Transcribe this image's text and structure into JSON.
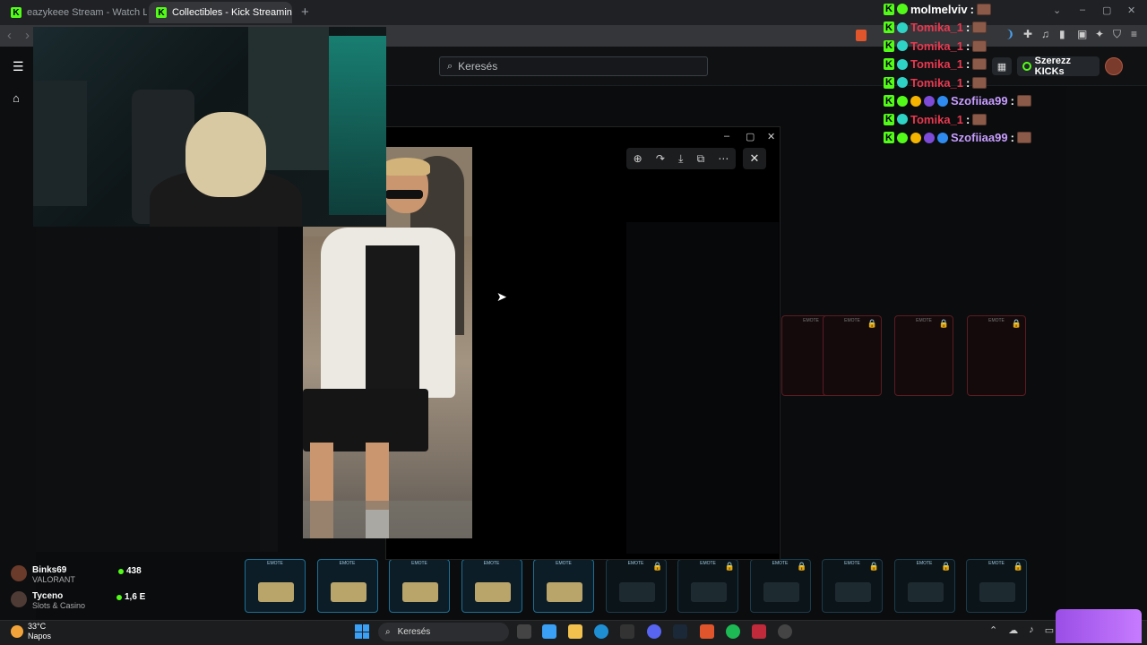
{
  "browser": {
    "tabs": [
      {
        "title": "eazykeee Stream - Watch Live on Kic",
        "active": false
      },
      {
        "title": "Collectibles - Kick Streaming",
        "active": true
      }
    ],
    "new_tab": "+",
    "window_controls": [
      "–",
      "▢",
      "✕"
    ]
  },
  "kick": {
    "search_placeholder": "Keresés",
    "earn_button": "Szerezz KICKs",
    "accent": "#53fc18"
  },
  "chat": [
    {
      "user": "molmelviv",
      "color": "#ffffff",
      "badges": [
        "sub"
      ]
    },
    {
      "user": "Tomika_1",
      "color": "#e8384f",
      "badges": [
        "sub-teal"
      ]
    },
    {
      "user": "Tomika_1",
      "color": "#e8384f",
      "badges": [
        "sub-teal"
      ]
    },
    {
      "user": "Tomika_1",
      "color": "#e8384f",
      "badges": [
        "sub-teal"
      ]
    },
    {
      "user": "Tomika_1",
      "color": "#e8384f",
      "badges": [
        "sub-teal"
      ]
    },
    {
      "user": "Szofiiaa99",
      "color": "#c89dff",
      "badges": [
        "sub",
        "crown",
        "gift",
        "vip"
      ]
    },
    {
      "user": "Tomika_1",
      "color": "#e8384f",
      "badges": [
        "sub-teal"
      ]
    },
    {
      "user": "Szofiiaa99",
      "color": "#c89dff",
      "badges": [
        "sub",
        "crown",
        "gift",
        "vip"
      ]
    }
  ],
  "chat_colon": ":",
  "emote_cards_top": [
    {
      "label": "EMOTE",
      "locked": true
    },
    {
      "label": "EMOTE",
      "locked": true
    },
    {
      "label": "EMOTE",
      "locked": true
    },
    {
      "label": "EMOTE",
      "locked": true
    }
  ],
  "emote_cards_bottom": [
    {
      "label": "EMOTE",
      "locked": false
    },
    {
      "label": "EMOTE",
      "locked": false
    },
    {
      "label": "EMOTE",
      "locked": false
    },
    {
      "label": "EMOTE",
      "locked": false
    },
    {
      "label": "EMOTE",
      "locked": false
    },
    {
      "label": "EMOTE",
      "locked": true
    },
    {
      "label": "EMOTE",
      "locked": true
    },
    {
      "label": "EMOTE",
      "locked": true
    },
    {
      "label": "EMOTE",
      "locked": true
    },
    {
      "label": "EMOTE",
      "locked": true
    },
    {
      "label": "EMOTE",
      "locked": true
    }
  ],
  "recommended": [
    {
      "name": "Binks69",
      "category": "VALORANT",
      "viewers": "438"
    },
    {
      "name": "Tyceno",
      "category": "Slots & Casino",
      "viewers": "1,6 E"
    }
  ],
  "taskbar": {
    "weather_temp": "33°C",
    "weather_desc": "Napos",
    "search_label": "Keresés"
  }
}
